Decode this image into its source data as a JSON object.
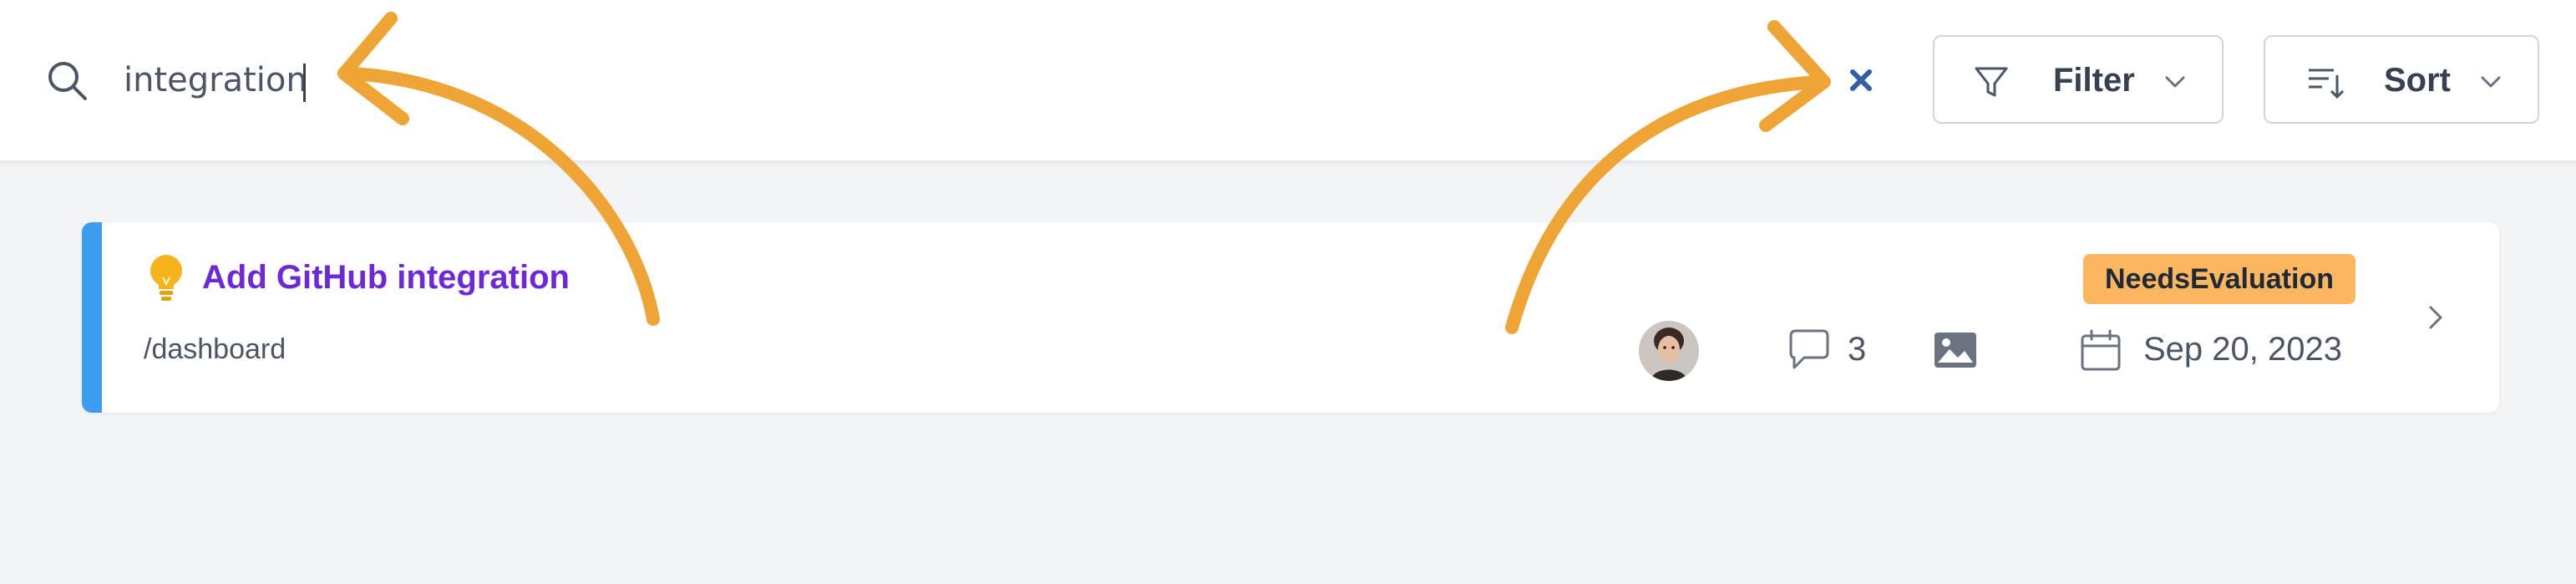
{
  "search": {
    "value": "integration",
    "icon": "search-icon"
  },
  "toolbar": {
    "clear_icon": "close-icon",
    "filter_label": "Filter",
    "sort_label": "Sort"
  },
  "results": [
    {
      "title": "Add GitHub integration",
      "path": "/dashboard",
      "comment_count": "3",
      "status": "NeedsEvaluation",
      "date": "Sep 20, 2023",
      "accent_color": "#3b9ef0",
      "status_color": "#fbb65f"
    }
  ],
  "colors": {
    "title": "#6d28d9",
    "annotation_arrow": "#eea536",
    "clear_icon": "#2f5fa8"
  }
}
